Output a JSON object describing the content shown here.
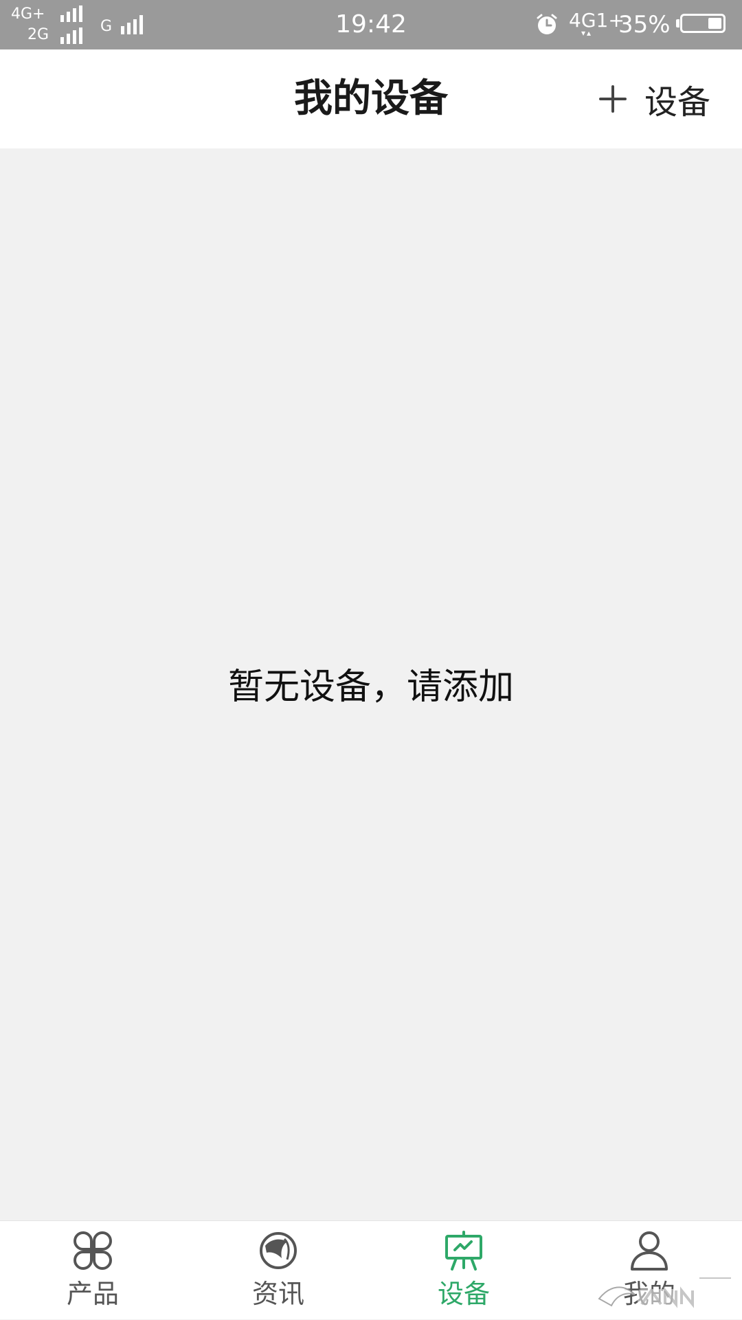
{
  "status_bar": {
    "network_left_1": "4G+",
    "network_left_2": "2G",
    "network_left_3": "G",
    "time": "19:42",
    "network_right": "4G1+",
    "battery_percent": "35%",
    "battery_level": 0.35
  },
  "header": {
    "title": "我的设备",
    "add_button_label": "设备",
    "add_icon": "plus-icon"
  },
  "content": {
    "empty_message": "暂无设备，请添加"
  },
  "bottom_nav": {
    "items": [
      {
        "label": "产品",
        "icon": "clover-grid-icon",
        "active": false
      },
      {
        "label": "资讯",
        "icon": "globe-icon",
        "active": false
      },
      {
        "label": "设备",
        "icon": "presentation-board-icon",
        "active": true
      },
      {
        "label": "我的",
        "icon": "user-icon",
        "active": false
      }
    ]
  },
  "colors": {
    "accent": "#2ea868",
    "status_bar_bg": "#9a9a9a",
    "content_bg": "#f1f1f1",
    "icon_gray": "#555555"
  }
}
